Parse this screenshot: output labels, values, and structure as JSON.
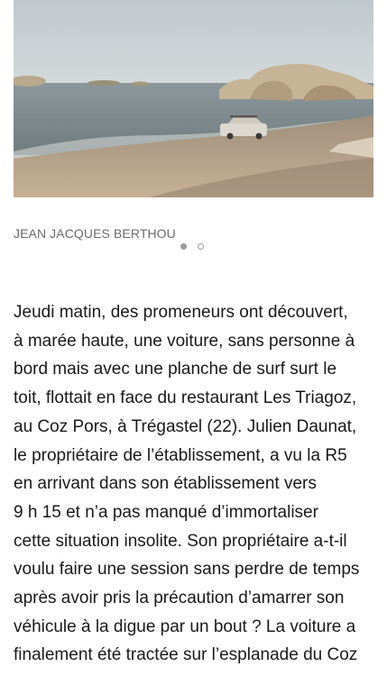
{
  "photo": {
    "alt": "car-in-sea-photo",
    "colors": {
      "sky": "#c9d1d4",
      "sea": "#7e8c92",
      "sand": "#b9a58c",
      "rock": "#c9b79c"
    }
  },
  "caption": {
    "credit": "JEAN JACQUES BERTHOU"
  },
  "carousel": {
    "total": 2,
    "active_index": 0
  },
  "article": {
    "lines": [
      "Jeudi matin, des promeneurs ont découvert,",
      "à marée haute, une voiture, sans personne à",
      "bord mais avec une planche de surf surt le",
      "toit, flottait en face du restaurant Les Triagoz,",
      "au Coz Pors, à Trégastel (22). Julien Daunat,",
      "le propriétaire de l’établissement, a vu la R5",
      "en arrivant dans son établissement vers",
      "9 h 15 et n’a pas manqué d’immortaliser",
      "cette situation insolite. Son propriétaire a-t-il",
      "voulu faire une session sans perdre de temps",
      "après avoir pris la précaution d’amarrer son",
      "véhicule à la digue par un bout ? La voiture a",
      "finalement été tractée sur l’esplanade du Coz"
    ]
  }
}
